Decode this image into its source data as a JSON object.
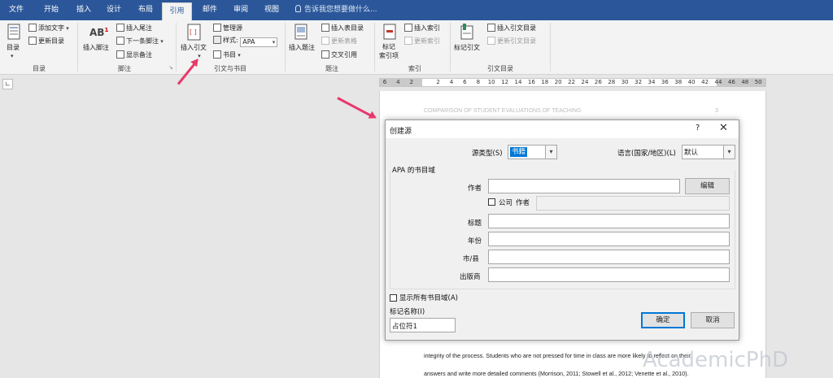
{
  "tabs": [
    "文件",
    "开始",
    "插入",
    "设计",
    "布局",
    "引用",
    "邮件",
    "审阅",
    "视图"
  ],
  "active_tab": "引用",
  "tell_me": "告诉我您想要做什么...",
  "ribbon": {
    "toc": {
      "label": "目录",
      "add_text": "添加文字",
      "update_toc": "更新目录",
      "group": "目录"
    },
    "footnotes": {
      "insert_footnote": "插入脚注",
      "insert_endnote": "插入尾注",
      "next_footnote": "下一条脚注",
      "show_notes": "显示备注",
      "group": "脚注"
    },
    "citations": {
      "insert_citation": "插入引文",
      "manage_sources": "管理源",
      "style_label": "样式:",
      "style_value": "APA",
      "bibliography": "书目",
      "group": "引文与书目"
    },
    "captions": {
      "insert_caption": "插入题注",
      "insert_table_of_figures": "插入表目录",
      "update_table": "更新表格",
      "cross_reference": "交叉引用",
      "group": "题注"
    },
    "index": {
      "mark_entry": "标记\n索引项",
      "insert_index": "插入索引",
      "update_index": "更新索引",
      "group": "索引"
    },
    "toa": {
      "mark_citation": "标记引文",
      "insert_toa": "插入引文目录",
      "update_toa": "更新引文目录",
      "group": "引文目录"
    }
  },
  "ruler_ticks": [
    "6",
    "4",
    "2",
    "",
    "2",
    "4",
    "6",
    "8",
    "10",
    "12",
    "14",
    "16",
    "18",
    "20",
    "22",
    "24",
    "26",
    "28",
    "30",
    "32",
    "34",
    "36",
    "38",
    "40",
    "42",
    "44",
    "46",
    "48",
    "50"
  ],
  "document": {
    "header": "COMPARISON OF STUDENT EVALUATIONS OF TEACHING",
    "page_number": "3",
    "line1": "integrity of the process. Students who are not pressed for time in class are more likely to reflect on their",
    "line2": "answers and write more detailed comments (Morrison, 2011; Stowell et al., 2012; Venette et al., 2010)."
  },
  "dialog": {
    "title": "创建源",
    "help": "?",
    "close": "✕",
    "source_type_label": "源类型(S)",
    "source_type_value": "书籍",
    "language_label": "语言(国家/地区)(L)",
    "language_value": "默认",
    "group_title": "APA 的书目域",
    "author_label": "作者",
    "author_value": "",
    "edit_button": "编辑",
    "corporate_checkbox": "公司",
    "corporate_author_label": "作者",
    "title_label": "标题",
    "year_label": "年份",
    "city_label": "市/县",
    "publisher_label": "出版商",
    "show_all_fields": "显示所有书目域(A)",
    "tag_name_label": "标记名称(I)",
    "tag_name_value": "占位符1",
    "ok_button": "确定",
    "cancel_button": "取消"
  },
  "watermark": "AcademicPhD",
  "colors": {
    "title_bar": "#2b579a",
    "ribbon": "#f3f3f3",
    "arrow": "#e8386b",
    "selection": "#0078d7"
  }
}
